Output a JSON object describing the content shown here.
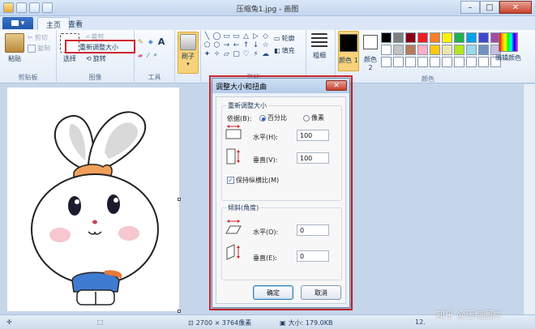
{
  "window": {
    "title": "压缩兔1.jpg - 画图"
  },
  "tabs": {
    "file": "▾",
    "home": "主页",
    "view": "查看"
  },
  "ribbon": {
    "clipboard": {
      "paste": "粘贴",
      "cut": "剪切",
      "copy": "复制",
      "label": "剪贴板"
    },
    "image": {
      "select": "选择",
      "crop": "裁剪",
      "resize": "重新调整大小",
      "rotate": "旋转",
      "label": "图像"
    },
    "tools": {
      "label": "工具"
    },
    "brushes": {
      "label": "刷子"
    },
    "shapes": {
      "outline": "轮廓",
      "fill": "填充",
      "label": "形状",
      "glyphs": [
        "╲",
        "◯",
        "▭",
        "▭",
        "△",
        "▷",
        "◇",
        "⬠",
        "⬡",
        "→",
        "←",
        "↑",
        "↓",
        "☆",
        "✦",
        "✧",
        "▱",
        "▢",
        "♡",
        "⚡",
        "☁"
      ]
    },
    "size": {
      "label": "粗细"
    },
    "color1": {
      "label": "颜色 1",
      "value": "#000000"
    },
    "color2": {
      "label": "颜色 2",
      "value": "#ffffff"
    },
    "colors": {
      "label": "颜色",
      "edit": "编辑颜色",
      "palette": [
        "#000000",
        "#7f7f7f",
        "#880015",
        "#ed1c24",
        "#ff7f27",
        "#fff200",
        "#22b14c",
        "#00a2e8",
        "#3f48cc",
        "#a349a4",
        "#ffffff",
        "#c3c3c3",
        "#b97a57",
        "#ffaec9",
        "#ffc90e",
        "#efe4b0",
        "#b5e61d",
        "#99d9ea",
        "#7092be",
        "#c8bfe7",
        "#ffffff",
        "#ffffff",
        "#ffffff",
        "#ffffff",
        "#ffffff",
        "#ffffff",
        "#ffffff",
        "#ffffff",
        "#ffffff",
        "#ffffff"
      ]
    }
  },
  "dialog": {
    "title": "调整大小和扭曲",
    "close": "✕",
    "resize_legend": "重新调整大小",
    "by_label": "依据(B):",
    "percent": "百分比",
    "pixels": "像素",
    "horizontal_label": "水平(H):",
    "horizontal_value": "100",
    "vertical_label": "垂直(V):",
    "vertical_value": "100",
    "keep_ratio": "保持纵横比(M)",
    "skew_legend": "倾斜(角度)",
    "skew_h_label": "水平(O):",
    "skew_h_value": "0",
    "skew_v_label": "垂直(E):",
    "skew_v_value": "0",
    "ok": "确定",
    "cancel": "取消"
  },
  "status": {
    "dimensions": "2700 × 3764像素",
    "size": "大小: 179.0KB",
    "zoom": "12."
  },
  "watermark": "知乎 @压缩图片"
}
